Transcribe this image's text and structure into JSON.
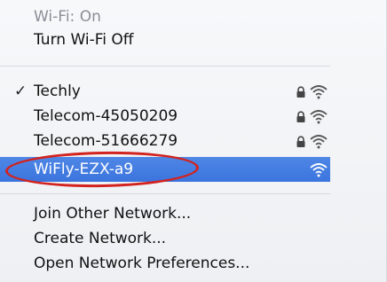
{
  "menu": {
    "status": "Wi-Fi: On",
    "toggle": "Turn Wi-Fi Off",
    "networks": [
      {
        "name": "Techly",
        "checked": true,
        "locked": true,
        "check_glyph": "✓"
      },
      {
        "name": "Telecom-45050209",
        "checked": false,
        "locked": true
      },
      {
        "name": "Telecom-51666279",
        "checked": false,
        "locked": true
      },
      {
        "name": "WiFly-EZX-a9",
        "checked": false,
        "locked": false,
        "selected": true
      }
    ],
    "actions": [
      "Join Other Network...",
      "Create Network...",
      "Open Network Preferences..."
    ]
  },
  "colors": {
    "selection": "#3b74dd",
    "annotation": "#d2231f"
  },
  "icons": [
    "lock-icon",
    "wifi-signal-icon",
    "checkmark-icon"
  ]
}
